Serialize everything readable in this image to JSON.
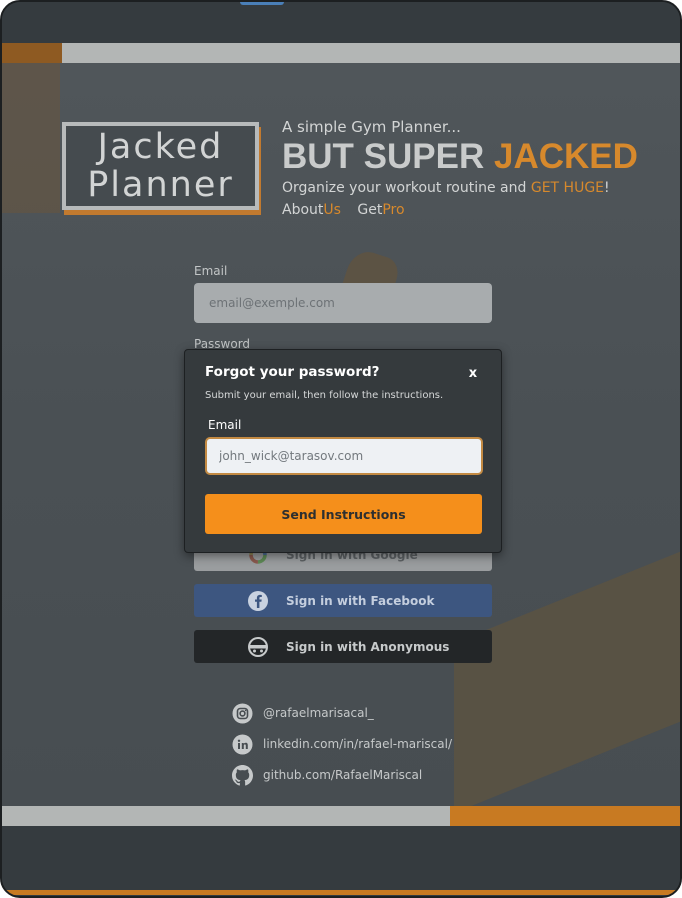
{
  "logo": {
    "line1": "Jacked",
    "line2": "Planner"
  },
  "hero": {
    "subtitle": "A simple Gym Planner...",
    "title_main": "BUT SUPER",
    "title_accent": "JACKED",
    "tagline_text": "Organize your workout routine and",
    "tagline_accent": "GET HUGE",
    "tagline_end": "!",
    "links": [
      {
        "text": "About",
        "accent": "Us"
      },
      {
        "text": "Get",
        "accent": "Pro"
      }
    ]
  },
  "login_form": {
    "email_label": "Email",
    "email_placeholder": "email@exemple.com",
    "password_label": "Password"
  },
  "social_login": {
    "google": "Sign in with Google",
    "facebook": "Sign in with Facebook",
    "anonymous": "Sign in with Anonymous"
  },
  "socials": [
    {
      "icon": "instagram-icon",
      "text": "@rafaelmarisacal_"
    },
    {
      "icon": "linkedin-icon",
      "text": "linkedin.com/in/rafael-mariscal/"
    },
    {
      "icon": "github-icon",
      "text": "github.com/RafaelMariscal"
    }
  ],
  "modal": {
    "title": "Forgot your password?",
    "close": "x",
    "subtitle": "Submit your email, then follow the instructions.",
    "email_label": "Email",
    "email_placeholder": "john_wick@tarasov.com",
    "submit": "Send Instructions"
  },
  "colors": {
    "accent": "#d7892c",
    "button_orange": "#f58f1b",
    "facebook": "#3d5680",
    "background": "#3b4145"
  }
}
